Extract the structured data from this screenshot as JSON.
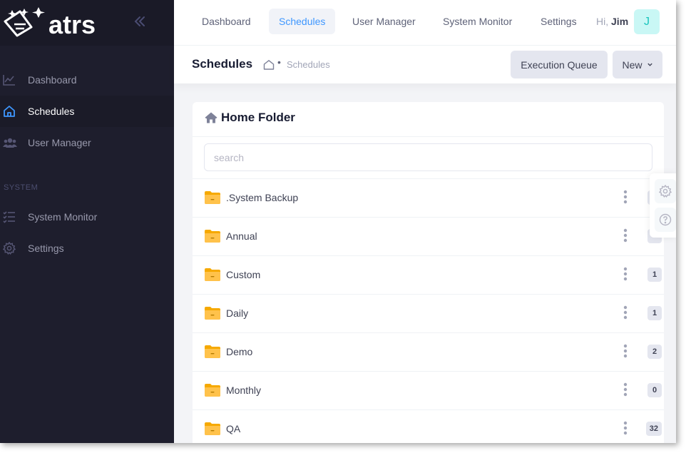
{
  "app": {
    "brand_text": "atrs"
  },
  "sidebar": {
    "items": [
      {
        "label": "Dashboard",
        "icon": "chart-line-icon",
        "active": false
      },
      {
        "label": "Schedules",
        "icon": "home-icon",
        "active": true
      },
      {
        "label": "User Manager",
        "icon": "users-icon",
        "active": false
      }
    ],
    "section_label": "SYSTEM",
    "system_items": [
      {
        "label": "System Monitor",
        "icon": "list-check-icon"
      },
      {
        "label": "Settings",
        "icon": "gear-icon"
      }
    ]
  },
  "header": {
    "tabs": [
      {
        "label": "Dashboard",
        "active": false
      },
      {
        "label": "Schedules",
        "active": true
      },
      {
        "label": "User Manager",
        "active": false
      },
      {
        "label": "System Monitor",
        "active": false
      },
      {
        "label": "Settings",
        "active": false
      }
    ],
    "greeting": "Hi,",
    "user_name": "Jim",
    "avatar_initial": "J"
  },
  "toolbar": {
    "title": "Schedules",
    "breadcrumb_current": "Schedules",
    "breadcrumb_separator": "•",
    "execution_queue_label": "Execution Queue",
    "new_label": "New"
  },
  "card": {
    "title": "Home Folder",
    "search_placeholder": "search",
    "folders": [
      {
        "name": ".System Backup",
        "count": ""
      },
      {
        "name": "Annual",
        "count": ""
      },
      {
        "name": "Custom",
        "count": "1"
      },
      {
        "name": "Daily",
        "count": "1"
      },
      {
        "name": "Demo",
        "count": "2"
      },
      {
        "name": "Monthly",
        "count": "0"
      },
      {
        "name": "QA",
        "count": "32"
      }
    ]
  },
  "colors": {
    "sidebar_bg": "#1e1e2d",
    "accent": "#3e97ff",
    "folder": "#ffc24b"
  }
}
